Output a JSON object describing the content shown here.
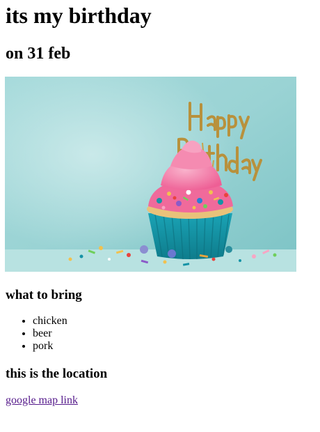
{
  "page": {
    "title": "its my birthday",
    "subtitle": "on 31 feb"
  },
  "image": {
    "subject": "cupcake",
    "banner_text": "Happy Birthday",
    "colors": {
      "background": "#9fd6d7",
      "frosting": "#f27aa8",
      "liner": "#1593a6",
      "cake": "#e9c27a",
      "topper": "#b58d3a"
    }
  },
  "bring": {
    "heading": "what to bring",
    "items": [
      "chicken",
      "beer",
      "pork"
    ]
  },
  "location": {
    "heading": "this is the location",
    "link_text": "google map link",
    "link_color": "#551a8b"
  }
}
